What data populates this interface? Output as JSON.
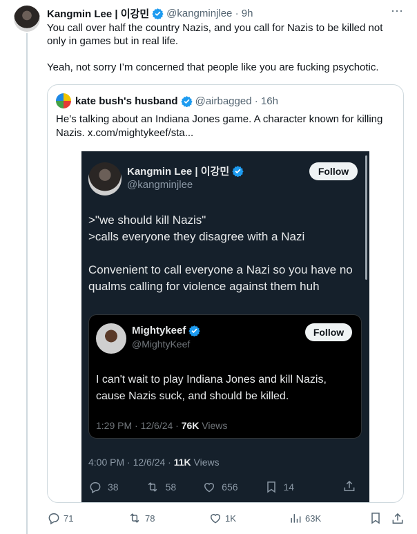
{
  "post": {
    "author_name": "Kangmin Lee | 이강민",
    "author_handle": "@kangminjlee",
    "time": "9h",
    "text_line1": "You call over half the country Nazis, and you call for Nazis to be killed not only in games but in real life.",
    "text_line2": "Yeah, not sorry I’m concerned that people like you are fucking psychotic.",
    "stats": {
      "replies": "71",
      "reposts": "78",
      "likes": "1K",
      "views": "63K"
    }
  },
  "quote": {
    "author_name": "kate bush's husband",
    "author_handle": "@airbagged",
    "time": "16h",
    "text": "He’s talking about an Indiana Jones game.  A character known for killing Nazis.  x.com/mightykeef/sta..."
  },
  "screenshot": {
    "author_name": "Kangmin Lee | 이강민",
    "author_handle": "@kangminjlee",
    "follow_label": "Follow",
    "line1": ">\"we should kill Nazis\"",
    "line2": ">calls everyone they disagree with a Nazi",
    "line3": "Convenient to call everyone a Nazi so you have no qualms calling for violence against them huh",
    "meta_time": "4:00 PM · 12/6/24 · ",
    "meta_views_count": "11K",
    "meta_views_label": " Views",
    "stats": {
      "replies": "38",
      "reposts": "58",
      "likes": "656",
      "bookmarks": "14"
    },
    "inner": {
      "author_name": "Mightykeef",
      "author_handle": "@MightyKeef",
      "follow_label": "Follow",
      "text": "I can't wait to play Indiana Jones and kill Nazis, cause Nazis suck, and should be killed.",
      "meta_time": "1:29 PM · 12/6/24 · ",
      "meta_views_count": "76K",
      "meta_views_label": " Views"
    }
  },
  "colors": {
    "verified_blue": "#1d9bf0",
    "muted_text": "#536471",
    "dark_bg": "#15202b",
    "border": "#cfd9de"
  },
  "icons": [
    "more-icon",
    "verified-badge-icon",
    "reply-icon",
    "repost-icon",
    "like-icon",
    "views-icon",
    "bookmark-icon",
    "share-icon"
  ]
}
